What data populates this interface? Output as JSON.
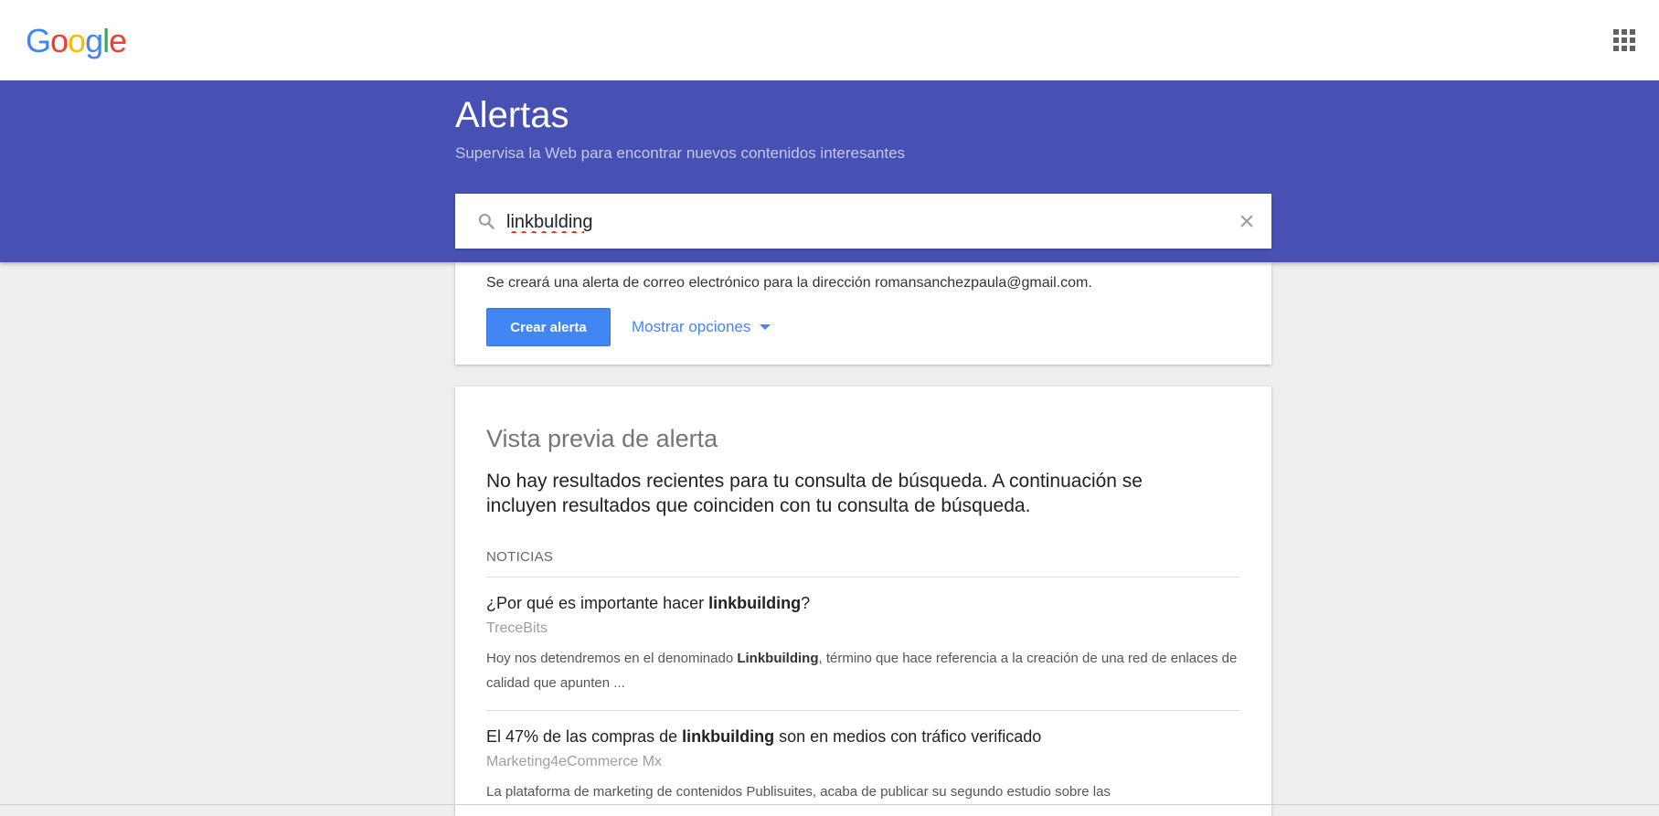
{
  "header": {
    "logo_letters": [
      {
        "char": "G",
        "color": "#4285f4"
      },
      {
        "char": "o",
        "color": "#ea4335"
      },
      {
        "char": "o",
        "color": "#fbbc05"
      },
      {
        "char": "g",
        "color": "#4285f4"
      },
      {
        "char": "l",
        "color": "#34a853"
      },
      {
        "char": "e",
        "color": "#ea4335"
      }
    ],
    "apps_icon": "apps-grid-icon"
  },
  "hero": {
    "title": "Alertas",
    "subtitle": "Supervisa la Web para encontrar nuevos contenidos interesantes",
    "background_color": "#4751b3"
  },
  "search": {
    "value": "linkbulding",
    "search_icon": "search-icon",
    "clear_icon": "close-icon"
  },
  "create_card": {
    "email_note": "Se creará una alerta de correo electrónico para la dirección romansanchezpaula@gmail.com.",
    "create_button": "Crear alerta",
    "options_link": "Mostrar opciones",
    "options_icon": "caret-down-icon",
    "accent_color": "#4285f4"
  },
  "preview": {
    "title": "Vista previa de alerta",
    "no_results": "No hay resultados recientes para tu consulta de búsqueda. A continuación se incluyen resultados que coinciden con tu consulta de búsqueda.",
    "section_label": "NOTICIAS",
    "results": [
      {
        "title_before": "¿Por qué es importante hacer ",
        "title_bold": "linkbuilding",
        "title_after": "?",
        "source": "TreceBits",
        "snippet_before": "Hoy nos detendremos en el denominado ",
        "snippet_bold": "Linkbuilding",
        "snippet_after": ", término que hace referencia a la creación de una red de enlaces de calidad que apunten ..."
      },
      {
        "title_before": "El 47% de las compras de ",
        "title_bold": "linkbuilding",
        "title_after": " son en medios con tráfico verificado",
        "source": "Marketing4eCommerce Mx",
        "snippet_before": "La plataforma de marketing de contenidos Publisuites, acaba de publicar su segundo estudio sobre las",
        "snippet_bold": "",
        "snippet_after": ""
      }
    ]
  }
}
